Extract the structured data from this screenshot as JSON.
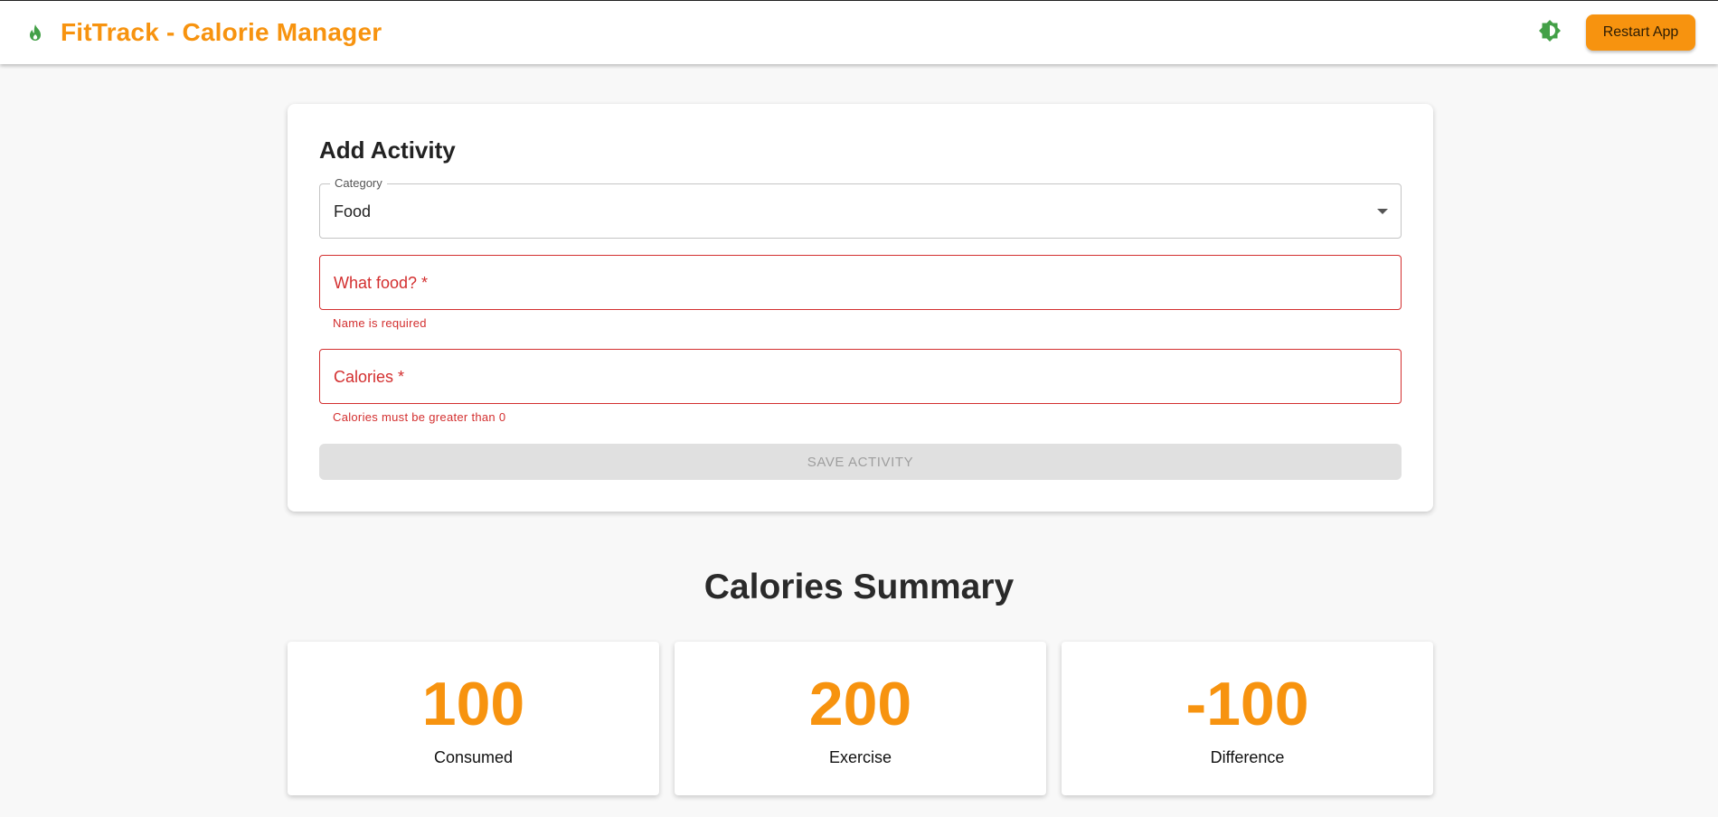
{
  "header": {
    "title": "FitTrack - Calorie Manager",
    "logo_icon": "flame-icon",
    "theme_icon": "brightness-icon",
    "restart_label": "Restart App",
    "accent_color": "#f7930f",
    "icon_color": "#43a047"
  },
  "form": {
    "title": "Add Activity",
    "category": {
      "label": "Category",
      "value": "Food"
    },
    "name_field": {
      "label": "What food? *",
      "value": "",
      "error": "Name is required"
    },
    "calories_field": {
      "label": "Calories *",
      "value": "",
      "error": "Calories must be greater than 0"
    },
    "save_label": "SAVE ACTIVITY",
    "error_color": "#d32f2f"
  },
  "summary": {
    "title": "Calories Summary",
    "stats": [
      {
        "value": "100",
        "label": "Consumed"
      },
      {
        "value": "200",
        "label": "Exercise"
      },
      {
        "value": "-100",
        "label": "Difference"
      }
    ]
  }
}
